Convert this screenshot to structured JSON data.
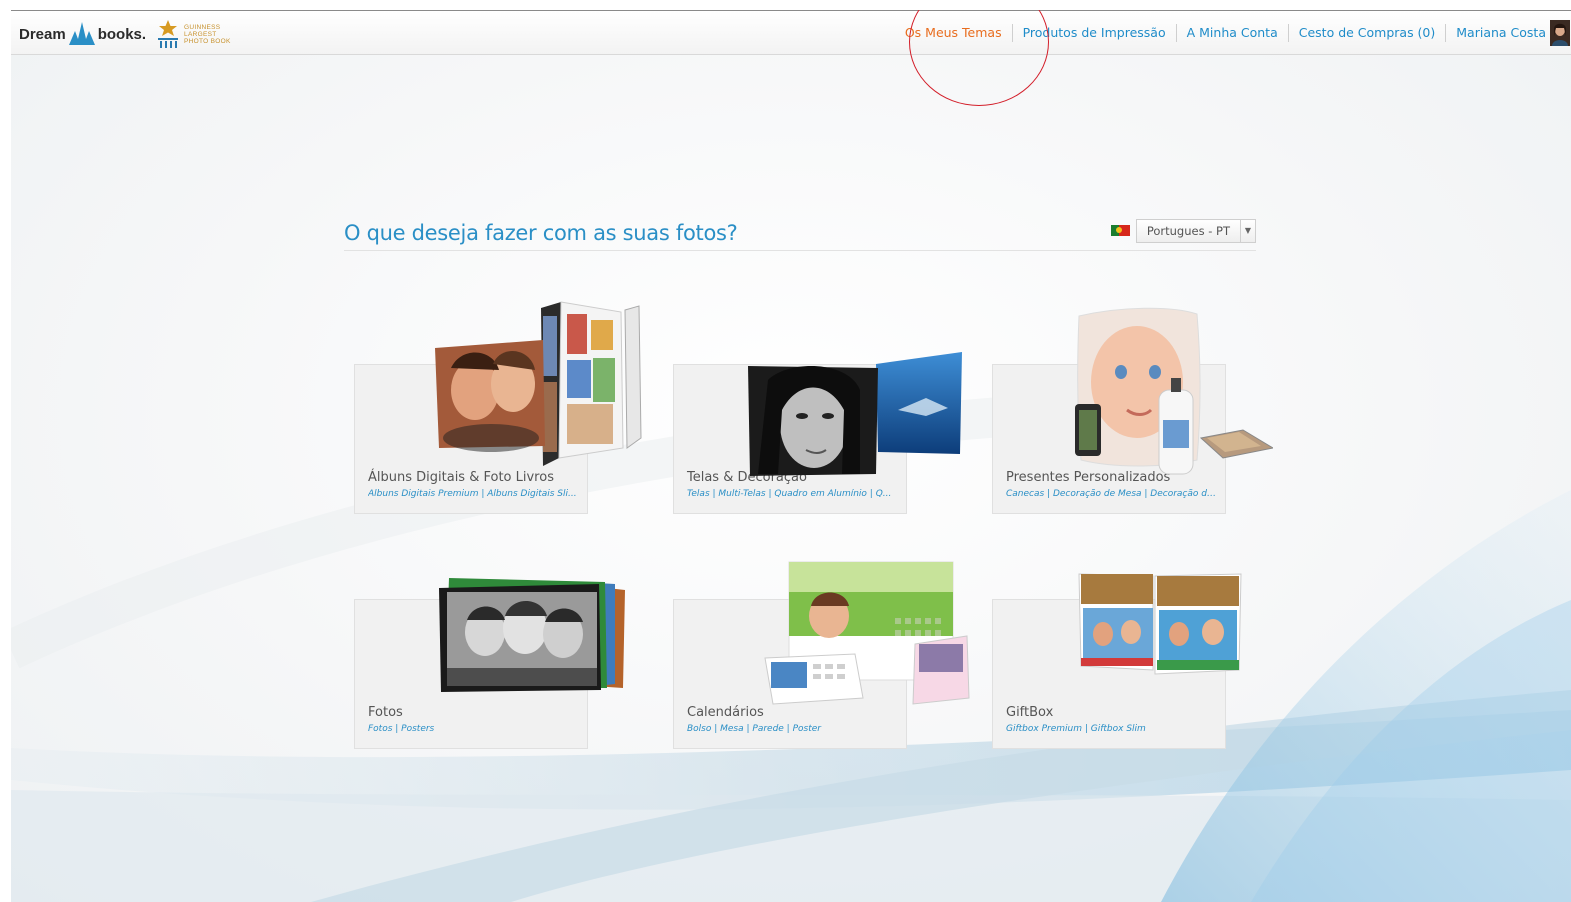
{
  "brand": {
    "name_part1": "Dream",
    "name_part2": "books.",
    "guinness_line1": "GUINNESS",
    "guinness_line2": "LARGEST",
    "guinness_line3": "PHOTO BOOK"
  },
  "nav": {
    "items": [
      {
        "label": "Os Meus Temas",
        "active": true
      },
      {
        "label": "Produtos de Impressão",
        "active": false
      },
      {
        "label": "A Minha Conta",
        "active": false
      },
      {
        "label": "Cesto de Compras (0)",
        "active": false
      },
      {
        "label": "Mariana Costa",
        "active": false
      }
    ]
  },
  "main": {
    "heading": "O que deseja fazer com as suas fotos?",
    "language": {
      "selected": "Portugues - PT",
      "flag": "portugal-flag"
    }
  },
  "categories": [
    {
      "title": "Álbuns Digitais & Foto Livros",
      "subtitle": "Álbuns Digitais Premium | Álbuns Digitais Sli..."
    },
    {
      "title": "Telas & Decoração",
      "subtitle": "Telas | Multi-Telas | Quadro em Alumínio | Q..."
    },
    {
      "title": "Presentes Personalizados",
      "subtitle": "Canecas | Decoração de Mesa | Decoração de..."
    },
    {
      "title": "Fotos",
      "subtitle": "Fotos | Posters"
    },
    {
      "title": "Calendários",
      "subtitle": "Bolso | Mesa | Parede | Poster"
    },
    {
      "title": "GiftBox",
      "subtitle": "Giftbox Premium | Giftbox Slim"
    }
  ],
  "colors": {
    "link": "#1f8cc9",
    "active_link": "#e86d1f",
    "annotation": "#d31f2a"
  }
}
